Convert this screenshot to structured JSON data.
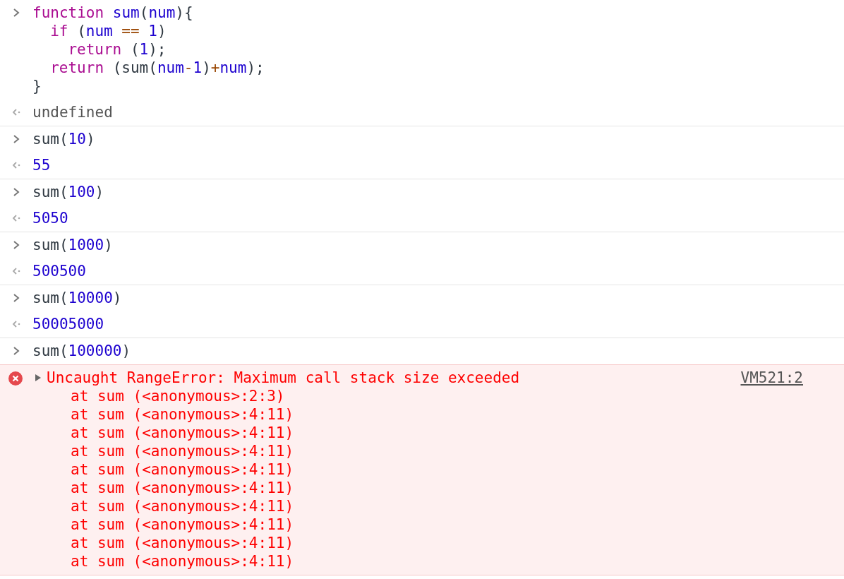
{
  "console": [
    {
      "kind": "input",
      "lines": [
        {
          "tokens": [
            {
              "text": "function",
              "kind": "keyword"
            },
            {
              "text": " sum",
              "kind": "name"
            },
            {
              "text": "(",
              "kind": "plain"
            },
            {
              "text": "num",
              "kind": "name"
            },
            {
              "text": "){",
              "kind": "plain"
            }
          ],
          "children": [
            {
              "tokens": [
                {
                  "text": "if",
                  "kind": "keyword"
                },
                {
                  "text": " (",
                  "kind": "plain"
                },
                {
                  "text": "num",
                  "kind": "name"
                },
                {
                  "text": " ==",
                  "kind": "operator"
                },
                {
                  "text": " 1",
                  "kind": "number"
                },
                {
                  "text": ")",
                  "kind": "plain"
                }
              ],
              "children": [
                {
                  "tokens": [
                    {
                      "text": "return",
                      "kind": "keyword"
                    },
                    {
                      "text": " (",
                      "kind": "plain"
                    },
                    {
                      "text": "1",
                      "kind": "number"
                    },
                    {
                      "text": ");",
                      "kind": "plain"
                    }
                  ]
                }
              ]
            },
            {
              "tokens": [
                {
                  "text": "return",
                  "kind": "keyword"
                },
                {
                  "text": " (sum(",
                  "kind": "plain"
                },
                {
                  "text": "num",
                  "kind": "name"
                },
                {
                  "text": "-",
                  "kind": "operator"
                },
                {
                  "text": "1",
                  "kind": "number"
                },
                {
                  "text": ")",
                  "kind": "plain"
                },
                {
                  "text": "+",
                  "kind": "operator"
                },
                {
                  "text": "num",
                  "kind": "name"
                },
                {
                  "text": ");",
                  "kind": "plain"
                }
              ]
            }
          ]
        },
        {
          "tokens": [
            {
              "text": "}",
              "kind": "plain"
            }
          ]
        }
      ]
    },
    {
      "kind": "undefined_result",
      "text": "undefined"
    },
    {
      "kind": "input",
      "lines": [
        {
          "tokens": [
            {
              "text": "sum(",
              "kind": "plain"
            },
            {
              "text": "10",
              "kind": "number"
            },
            {
              "text": ")",
              "kind": "plain"
            }
          ]
        }
      ]
    },
    {
      "kind": "number_result",
      "text": "55"
    },
    {
      "kind": "input",
      "lines": [
        {
          "tokens": [
            {
              "text": "sum(",
              "kind": "plain"
            },
            {
              "text": "100",
              "kind": "number"
            },
            {
              "text": ")",
              "kind": "plain"
            }
          ]
        }
      ]
    },
    {
      "kind": "number_result",
      "text": "5050"
    },
    {
      "kind": "input",
      "lines": [
        {
          "tokens": [
            {
              "text": "sum(",
              "kind": "plain"
            },
            {
              "text": "1000",
              "kind": "number"
            },
            {
              "text": ")",
              "kind": "plain"
            }
          ]
        }
      ]
    },
    {
      "kind": "number_result",
      "text": "500500"
    },
    {
      "kind": "input",
      "lines": [
        {
          "tokens": [
            {
              "text": "sum(",
              "kind": "plain"
            },
            {
              "text": "10000",
              "kind": "number"
            },
            {
              "text": ")",
              "kind": "plain"
            }
          ]
        }
      ]
    },
    {
      "kind": "number_result",
      "text": "50005000"
    },
    {
      "kind": "input",
      "lines": [
        {
          "tokens": [
            {
              "text": "sum(",
              "kind": "plain"
            },
            {
              "text": "100000",
              "kind": "number"
            },
            {
              "text": ")",
              "kind": "plain"
            }
          ]
        }
      ]
    },
    {
      "kind": "error",
      "message": "Uncaught RangeError: Maximum call stack size exceeded",
      "source": "VM521:2",
      "expanded": false,
      "stack": [
        "at sum (<anonymous>:2:3)",
        "at sum (<anonymous>:4:11)",
        "at sum (<anonymous>:4:11)",
        "at sum (<anonymous>:4:11)",
        "at sum (<anonymous>:4:11)",
        "at sum (<anonymous>:4:11)",
        "at sum (<anonymous>:4:11)",
        "at sum (<anonymous>:4:11)",
        "at sum (<anonymous>:4:11)",
        "at sum (<anonymous>:4:11)"
      ]
    }
  ]
}
